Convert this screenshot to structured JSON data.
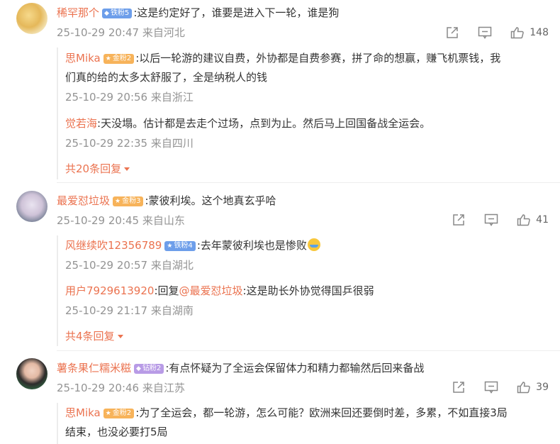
{
  "comments": [
    {
      "user": "稀罕那个",
      "badge": "铁粉5",
      "text": ":这是约定好了，谁要是进入下一轮，谁是狗",
      "time": "25-10-29 20:47 来自河北",
      "likes": "148",
      "replies": [
        {
          "user": "思Mika",
          "badge": "金粉2",
          "text1": ":以后一轮游的建议自费，外协都是自费参赛，拼了命的想赢，赚飞机票钱，我",
          "text2": "们真的给的太多太舒服了，全是纳税人的钱",
          "time": "25-10-29 20:56 来自浙江"
        },
        {
          "user": "觉若海",
          "text": ":天没塌。估计都是去走个过场，点到为止。然后马上回国备战全运会。",
          "time": "25-10-29 22:35 来自四川"
        }
      ],
      "more": "共20条回复"
    },
    {
      "user": "最爱怼垃圾",
      "badge": "金粉3",
      "text": ":蒙彼利埃。这个地真玄乎哈",
      "time": "25-10-29 20:45 来自山东",
      "likes": "41",
      "replies": [
        {
          "user": "风继续吹12356789",
          "badge": "铁粉4",
          "text": ":去年蒙彼利埃也是惨败",
          "time": "25-10-29 20:57 来自湖北"
        },
        {
          "user": "用户7929613920",
          "pre": ":回复",
          "mention": "@最爱怼垃圾",
          "text": ":这是助长外协觉得国乒很弱",
          "time": "25-10-29 21:17 来自湖南"
        }
      ],
      "more": "共4条回复"
    },
    {
      "user": "薯条果仁糯米糍",
      "badge": "钻粉2",
      "text": ":有点怀疑为了全运会保留体力和精力都输然后回来备战",
      "time": "25-10-29 20:46 来自江苏",
      "likes": "39",
      "replies": [
        {
          "user": "思Mika",
          "badge": "金粉2",
          "text1": ":为了全运会，都一轮游，怎么可能？欧洲来回还要倒时差，多累，不如直接3局",
          "text2": "结束，也没必要打5局"
        }
      ]
    }
  ]
}
